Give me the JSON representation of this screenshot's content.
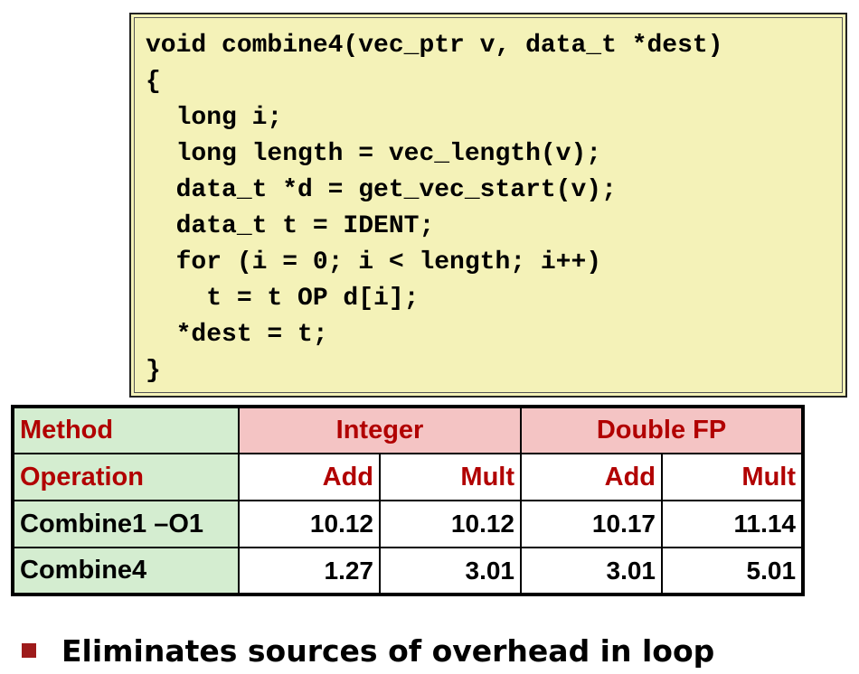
{
  "code": {
    "lines": [
      "void combine4(vec_ptr v, data_t *dest)",
      "{",
      "  long i;",
      "  long length = vec_length(v);",
      "  data_t *d = get_vec_start(v);",
      "  data_t t = IDENT;",
      "  for (i = 0; i < length; i++)",
      "    t = t OP d[i];",
      "  *dest = t;",
      "}"
    ]
  },
  "table": {
    "method_label": "Method",
    "integer_label": "Integer",
    "double_label": "Double FP",
    "operation_label": "Operation",
    "ops": [
      "Add",
      "Mult",
      "Add",
      "Mult"
    ],
    "rows": [
      {
        "name": "Combine1 –O1",
        "values": [
          "10.12",
          "10.12",
          "10.17",
          "11.14"
        ]
      },
      {
        "name": "Combine4",
        "values": [
          "1.27",
          "3.01",
          "3.01",
          "5.01"
        ]
      }
    ]
  },
  "bullet": {
    "text": "Eliminates sources of overhead in loop"
  },
  "colors": {
    "code_bg": "#f4f2b8",
    "label_bg": "#d4edd0",
    "group_bg": "#f4c4c4",
    "accent_red": "#b10000",
    "bullet": "#9e1b1b"
  }
}
